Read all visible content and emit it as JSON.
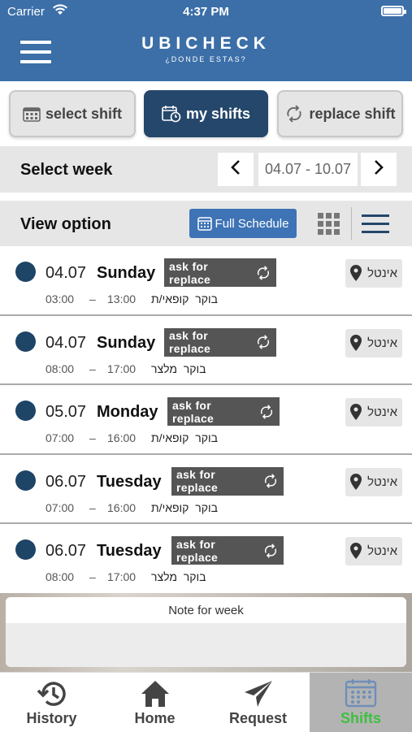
{
  "status_bar": {
    "carrier": "Carrier",
    "time": "4:37 PM"
  },
  "app": {
    "logo_name": "UBICHECK",
    "logo_sub": "¿DONDE ESTAS?"
  },
  "top_tabs": [
    {
      "label": "select shift",
      "icon": "calendar-grid-icon",
      "active": false
    },
    {
      "label": "my shifts",
      "icon": "calendar-clock-icon",
      "active": true
    },
    {
      "label": "replace shift",
      "icon": "replace-arrows-icon",
      "active": false
    }
  ],
  "week": {
    "label": "Select week",
    "range": "04.07 - 10.07"
  },
  "view": {
    "label": "View option",
    "full_schedule": "Full Schedule"
  },
  "shifts": [
    {
      "date": "04.07",
      "day": "Sunday",
      "ask": "ask for replace",
      "location": "אינטל",
      "start": "03:00",
      "dash": "–",
      "end": "13:00",
      "period": "בוקר",
      "role": "קופאי/ת"
    },
    {
      "date": "04.07",
      "day": "Sunday",
      "ask": "ask for replace",
      "location": "אינטל",
      "start": "08:00",
      "dash": "–",
      "end": "17:00",
      "period": "בוקר",
      "role": "מלצר"
    },
    {
      "date": "05.07",
      "day": "Monday",
      "ask": "ask for replace",
      "location": "אינטל",
      "start": "07:00",
      "dash": "–",
      "end": "16:00",
      "period": "בוקר",
      "role": "קופאי/ת"
    },
    {
      "date": "06.07",
      "day": "Tuesday",
      "ask": "ask for replace",
      "location": "אינטל",
      "start": "07:00",
      "dash": "–",
      "end": "16:00",
      "period": "בוקר",
      "role": "קופאי/ת"
    },
    {
      "date": "06.07",
      "day": "Tuesday",
      "ask": "ask for replace",
      "location": "אינטל",
      "start": "08:00",
      "dash": "–",
      "end": "17:00",
      "period": "בוקר",
      "role": "מלצר"
    }
  ],
  "note": {
    "title": "Note for week"
  },
  "tabbar": [
    {
      "label": "History",
      "icon": "history-icon",
      "active": false
    },
    {
      "label": "Home",
      "icon": "home-icon",
      "active": false
    },
    {
      "label": "Request",
      "icon": "paper-plane-icon",
      "active": false
    },
    {
      "label": "Shifts",
      "icon": "calendar-icon",
      "active": true
    }
  ],
  "colors": {
    "header": "#3c6fa8",
    "active_tab": "#24476b",
    "dot": "#1e4466",
    "active_bottom_tab_text": "#3fbf3f"
  }
}
